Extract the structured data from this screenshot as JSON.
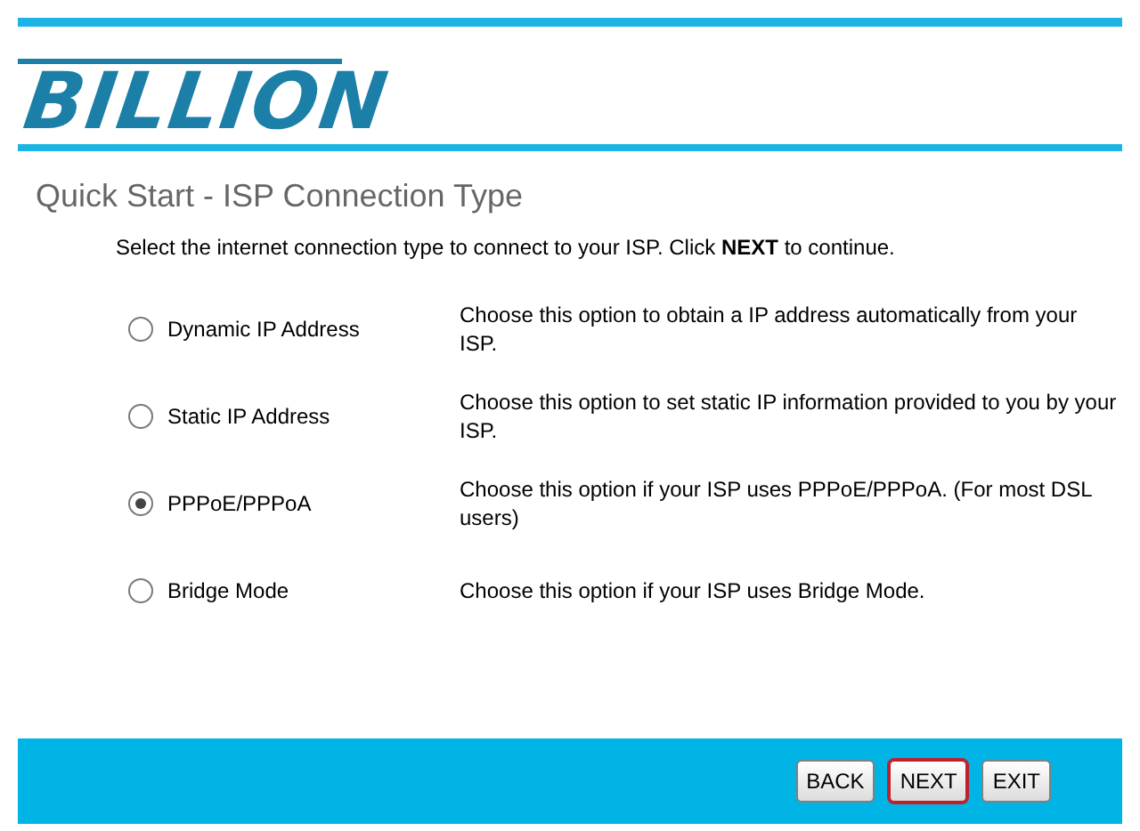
{
  "logo": {
    "text": "BILLION"
  },
  "title": "Quick Start - ISP Connection Type",
  "instruction": "Select the internet connection type to connect to your ISP. Click **NEXT** to continue.",
  "options": [
    {
      "label": "Dynamic IP Address",
      "description": "Choose this option to obtain a IP address automatically from your ISP.",
      "selected": false
    },
    {
      "label": "Static IP Address",
      "description": "Choose this option to set static IP information provided to you by your ISP.",
      "selected": false
    },
    {
      "label": "PPPoE/PPPoA",
      "description": "Choose this option if your ISP uses PPPoE/PPPoA. (For most DSL users)",
      "selected": true
    },
    {
      "label": "Bridge Mode",
      "description": "Choose this option if your ISP uses Bridge Mode.",
      "selected": false
    }
  ],
  "buttons": [
    {
      "label": "BACK",
      "focused": false
    },
    {
      "label": "NEXT",
      "focused": true
    },
    {
      "label": "EXIT",
      "focused": false
    }
  ]
}
